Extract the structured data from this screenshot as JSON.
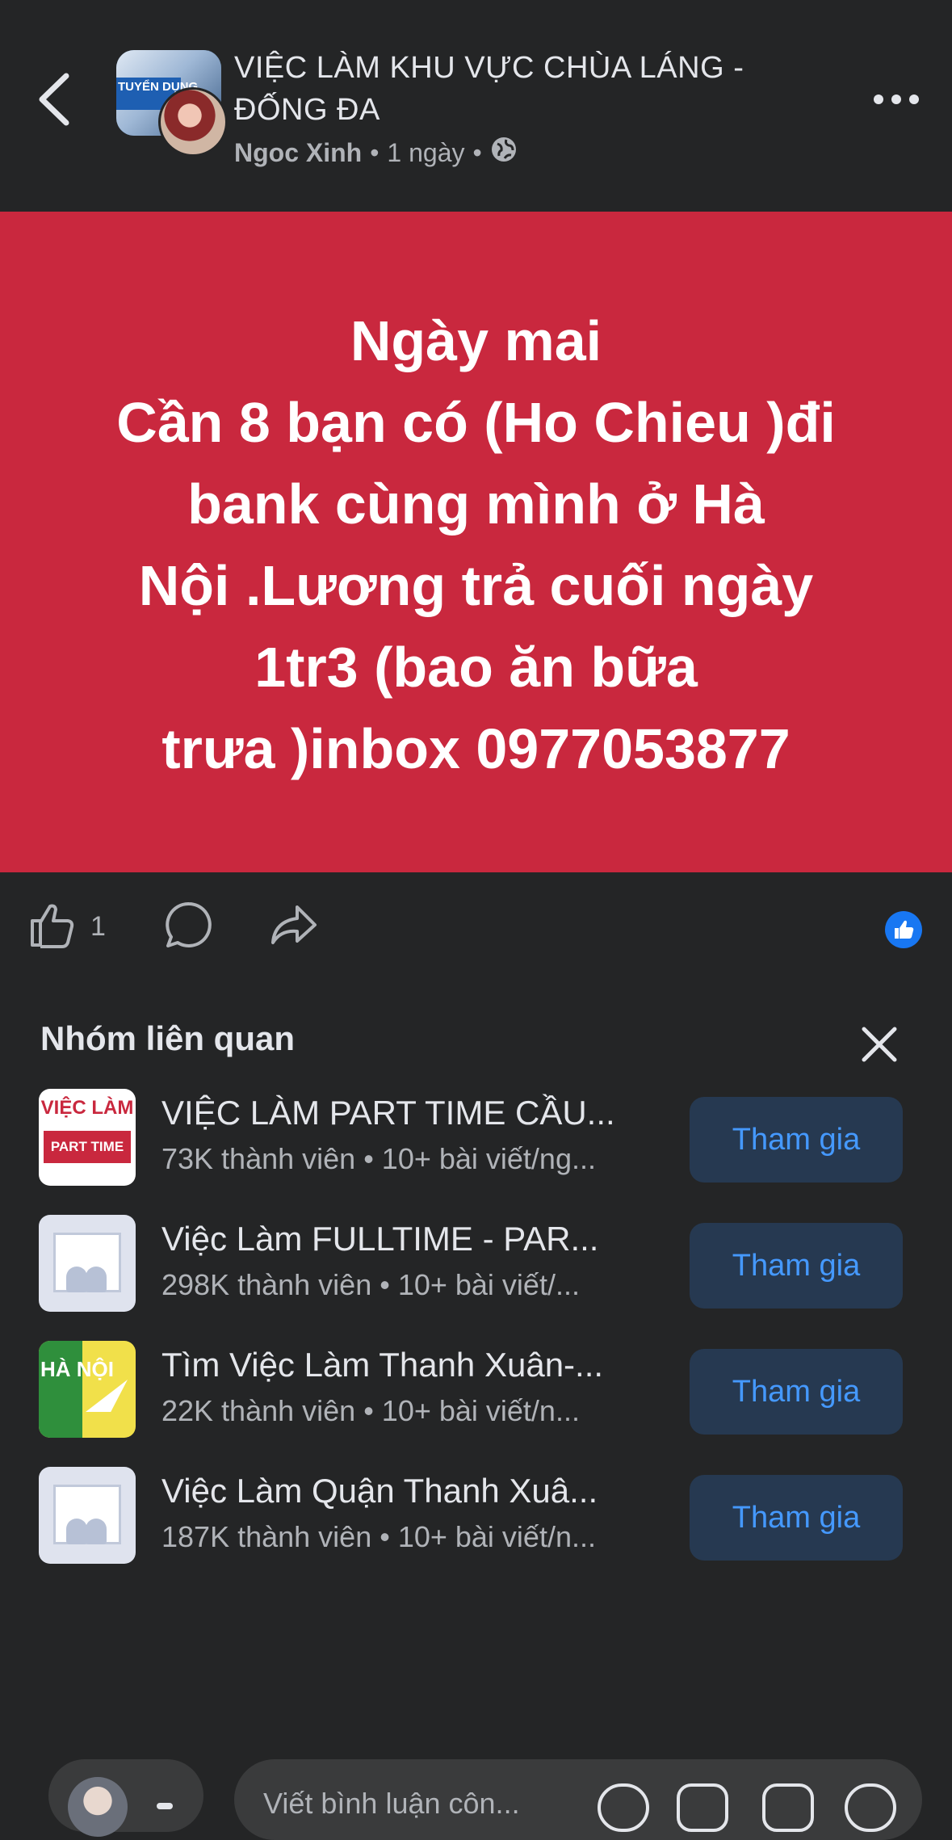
{
  "header": {
    "group_title": "VIỆC LÀM KHU VỰC CHÙA LÁNG - ĐỐNG ĐA",
    "author": "Ngoc Xinh",
    "time": "1 ngày",
    "separator": "•",
    "avatar_text": "TUYỂN DỤNG"
  },
  "post": {
    "text": "Ngày mai\nCần 8 bạn có (Ho Chieu )đi\nbank cùng mình ở Hà\nNội .Lương trả cuối ngày\n1tr3 (bao ăn bữa\ntrưa )inbox 0977053877",
    "background_color": "#c9283e",
    "like_count": "1"
  },
  "related": {
    "title": "Nhóm liên quan",
    "groups": [
      {
        "name": "VIỆC LÀM PART TIME CẦU...",
        "meta": "73K thành viên • 10+ bài viết/ng...",
        "join_label": "Tham gia",
        "thumb_top": "VIỆC LÀM",
        "thumb_band": "PART TIME"
      },
      {
        "name": "Việc Làm FULLTIME - PAR...",
        "meta": "298K thành viên • 10+ bài viết/...",
        "join_label": "Tham gia"
      },
      {
        "name": "Tìm Việc Làm Thanh Xuân-...",
        "meta": "22K thành viên • 10+ bài viết/n...",
        "join_label": "Tham gia",
        "thumb_text": "HÀ NỘI"
      },
      {
        "name": "Việc Làm Quận Thanh Xuâ...",
        "meta": "187K thành viên • 10+ bài viết/n...",
        "join_label": "Tham gia"
      }
    ]
  },
  "composer": {
    "placeholder": "Viết bình luận côn..."
  },
  "colors": {
    "background": "#242526",
    "accent": "#1877f2",
    "join_bg": "#263951",
    "join_text": "#4599ff"
  },
  "icons": [
    "back-arrow-icon",
    "more-icon",
    "globe-icon",
    "like-icon",
    "comment-icon",
    "share-icon",
    "like-reaction-icon",
    "close-icon",
    "emoji-icon",
    "camera-icon",
    "gif-icon",
    "smiley-icon"
  ]
}
